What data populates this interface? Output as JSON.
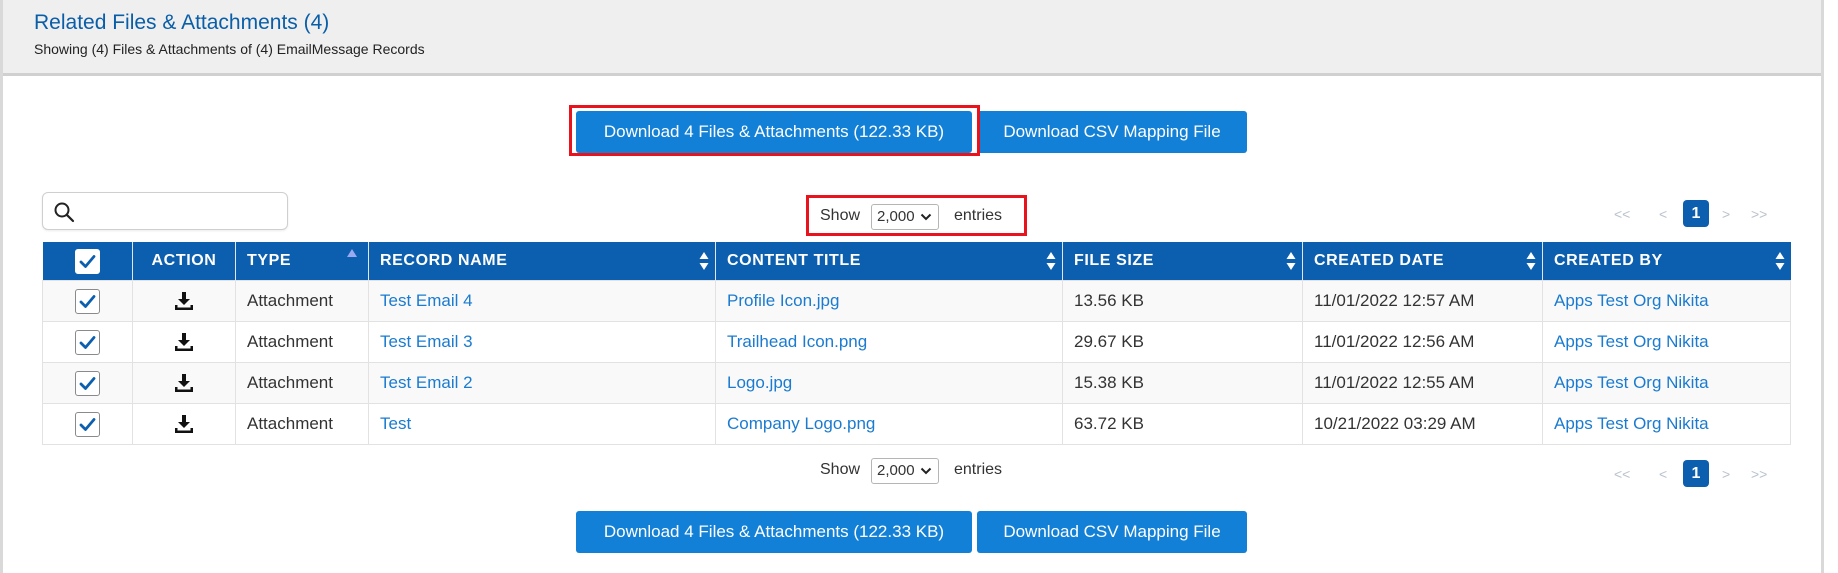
{
  "header": {
    "title": "Related Files & Attachments (4)",
    "subtitle": "Showing (4) Files & Attachments of (4) EmailMessage Records"
  },
  "buttons": {
    "download_label": "Download 4 Files & Attachments (122.33 KB)",
    "csv_label": "Download CSV Mapping File"
  },
  "search": {
    "placeholder": "",
    "value": ""
  },
  "length": {
    "show_label": "Show",
    "selected": "2,000",
    "entries_label": "entries"
  },
  "pagination": {
    "first": "<<",
    "prev": "<",
    "current": "1",
    "next": ">",
    "last": ">>"
  },
  "table": {
    "columns": {
      "action": "ACTION",
      "type": "TYPE",
      "record_name": "RECORD NAME",
      "content_title": "CONTENT TITLE",
      "file_size": "FILE SIZE",
      "created_date": "CREATED DATE",
      "created_by": "CREATED BY"
    },
    "rows": [
      {
        "checked": true,
        "type": "Attachment",
        "record_name": "Test Email 4",
        "content_title": "Profile Icon.jpg",
        "file_size": "13.56 KB",
        "created_date": "11/01/2022 12:57 AM",
        "created_by": "Apps Test Org Nikita"
      },
      {
        "checked": true,
        "type": "Attachment",
        "record_name": "Test Email 3",
        "content_title": "Trailhead Icon.png",
        "file_size": "29.67 KB",
        "created_date": "11/01/2022 12:56 AM",
        "created_by": "Apps Test Org Nikita"
      },
      {
        "checked": true,
        "type": "Attachment",
        "record_name": "Test Email 2",
        "content_title": "Logo.jpg",
        "file_size": "15.38 KB",
        "created_date": "11/01/2022 12:55 AM",
        "created_by": "Apps Test Org Nikita"
      },
      {
        "checked": true,
        "type": "Attachment",
        "record_name": "Test",
        "content_title": "Company Logo.png",
        "file_size": "63.72 KB",
        "created_date": "10/21/2022 03:29 AM",
        "created_by": "Apps Test Org Nikita"
      }
    ]
  },
  "colors": {
    "accent": "#1280d6",
    "header_blue": "#0c5fae",
    "link": "#1a7bd0",
    "highlight": "#e8131c"
  }
}
